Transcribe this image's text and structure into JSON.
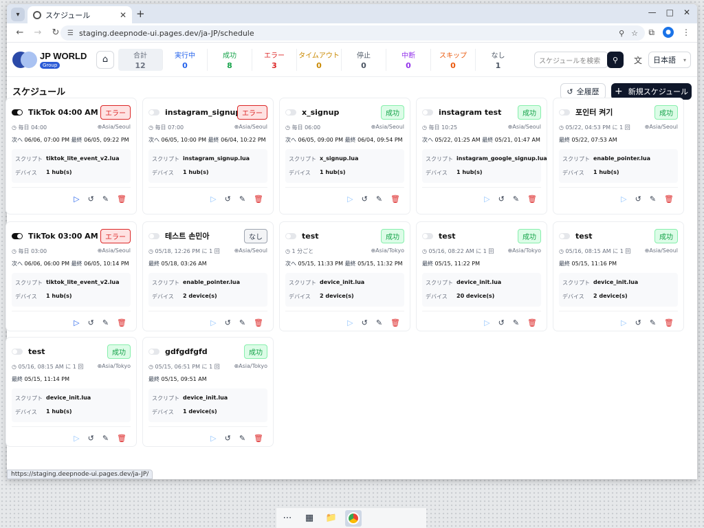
{
  "browser": {
    "tab_title": "スケジュール",
    "url": "staging.deepnode-ui.pages.dev/ja-JP/schedule",
    "status_url": "https://staging.deepnode-ui.pages.dev/ja-JP/"
  },
  "header": {
    "logo_title": "JP WORLD",
    "logo_badge": "Group",
    "stats": [
      {
        "label": "合計",
        "value": "12",
        "color": "#6b7280"
      },
      {
        "label": "実行中",
        "value": "0",
        "color": "#2563eb"
      },
      {
        "label": "成功",
        "value": "8",
        "color": "#16a34a"
      },
      {
        "label": "エラー",
        "value": "3",
        "color": "#dc2626"
      },
      {
        "label": "タイムアウト",
        "value": "0",
        "color": "#ca8a04"
      },
      {
        "label": "停止",
        "value": "0",
        "color": "#4b5563"
      },
      {
        "label": "中断",
        "value": "0",
        "color": "#9333ea"
      },
      {
        "label": "スキップ",
        "value": "0",
        "color": "#ea580c"
      },
      {
        "label": "なし",
        "value": "1",
        "color": "#4b5563"
      }
    ],
    "search_placeholder": "スケジュールを検索",
    "language": "日本語"
  },
  "page": {
    "title": "スケジュール",
    "history_button": "全履歴",
    "new_button": "新規スケジュール"
  },
  "labels": {
    "script": "スクリプト",
    "device": "デバイス",
    "next": "次へ",
    "last": "最終"
  },
  "cards": [
    {
      "title": "TikTok 04:00 AM",
      "enabled": true,
      "status": "エラー",
      "status_type": "err",
      "schedule": "毎日 04:00",
      "tz": "Asia/Seoul",
      "next": "06/06, 07:00 PM",
      "last": "06/05, 09:22 PM",
      "script": "tiktok_lite_event_v2.lua",
      "device": "1 hub(s)"
    },
    {
      "title": "instagram_signup",
      "enabled": false,
      "status": "エラー",
      "status_type": "err",
      "schedule": "毎日 07:00",
      "tz": "Asia/Seoul",
      "next": "06/05, 10:00 PM",
      "last": "06/04, 10:22 PM",
      "script": "instagram_signup.lua",
      "device": "1 hub(s)"
    },
    {
      "title": "x_signup",
      "enabled": false,
      "status": "成功",
      "status_type": "ok",
      "schedule": "毎日 06:00",
      "tz": "Asia/Seoul",
      "next": "06/05, 09:00 PM",
      "last": "06/04, 09:54 PM",
      "script": "x_signup.lua",
      "device": "1 hub(s)"
    },
    {
      "title": "instagram test",
      "enabled": false,
      "status": "成功",
      "status_type": "ok",
      "schedule": "毎日 10:25",
      "tz": "Asia/Seoul",
      "next": "05/22, 01:25 AM",
      "last": "05/21, 01:47 AM",
      "script": "instagram_google_signup.lua",
      "device": "1 hub(s)"
    },
    {
      "title": "포인터 켜기",
      "enabled": false,
      "status": "成功",
      "status_type": "ok",
      "schedule": "05/22, 04:53 PM に 1 回",
      "tz": "Asia/Seoul",
      "next": "",
      "last": "05/22, 07:53 AM",
      "script": "enable_pointer.lua",
      "device": "1 hub(s)"
    },
    {
      "title": "TikTok 03:00 AM",
      "enabled": true,
      "status": "エラー",
      "status_type": "err",
      "schedule": "毎日 03:00",
      "tz": "Asia/Seoul",
      "next": "06/06, 06:00 PM",
      "last": "06/05, 10:14 PM",
      "script": "tiktok_lite_event_v2.lua",
      "device": "1 hub(s)"
    },
    {
      "title": "테스트 손민아",
      "enabled": false,
      "status": "なし",
      "status_type": "none",
      "schedule": "05/18, 12:26 PM に 1 回",
      "tz": "Asia/Seoul",
      "next": "",
      "last": "05/18, 03:26 AM",
      "script": "enable_pointer.lua",
      "device": "2 device(s)"
    },
    {
      "title": "test",
      "enabled": false,
      "status": "成功",
      "status_type": "ok",
      "schedule": "1 分ごと",
      "tz": "Asia/Tokyo",
      "next": "05/15, 11:33 PM",
      "last": "05/15, 11:32 PM",
      "script": "device_init.lua",
      "device": "2 device(s)"
    },
    {
      "title": "test",
      "enabled": false,
      "status": "成功",
      "status_type": "ok",
      "schedule": "05/16, 08:22 AM に 1 回",
      "tz": "Asia/Tokyo",
      "next": "",
      "last": "05/15, 11:22 PM",
      "script": "device_init.lua",
      "device": "20 device(s)"
    },
    {
      "title": "test",
      "enabled": false,
      "status": "成功",
      "status_type": "ok",
      "schedule": "05/16, 08:15 AM に 1 回",
      "tz": "Asia/Seoul",
      "next": "",
      "last": "05/15, 11:16 PM",
      "script": "device_init.lua",
      "device": "2 device(s)"
    },
    {
      "title": "test",
      "enabled": false,
      "status": "成功",
      "status_type": "ok",
      "schedule": "05/16, 08:15 AM に 1 回",
      "tz": "Asia/Tokyo",
      "next": "",
      "last": "05/15, 11:14 PM",
      "script": "device_init.lua",
      "device": "1 hub(s)"
    },
    {
      "title": "gdfgdfgfd",
      "enabled": false,
      "status": "成功",
      "status_type": "ok",
      "schedule": "05/15, 06:51 PM に 1 回",
      "tz": "Asia/Tokyo",
      "next": "",
      "last": "05/15, 09:51 AM",
      "script": "device_init.lua",
      "device": "1 device(s)"
    }
  ]
}
